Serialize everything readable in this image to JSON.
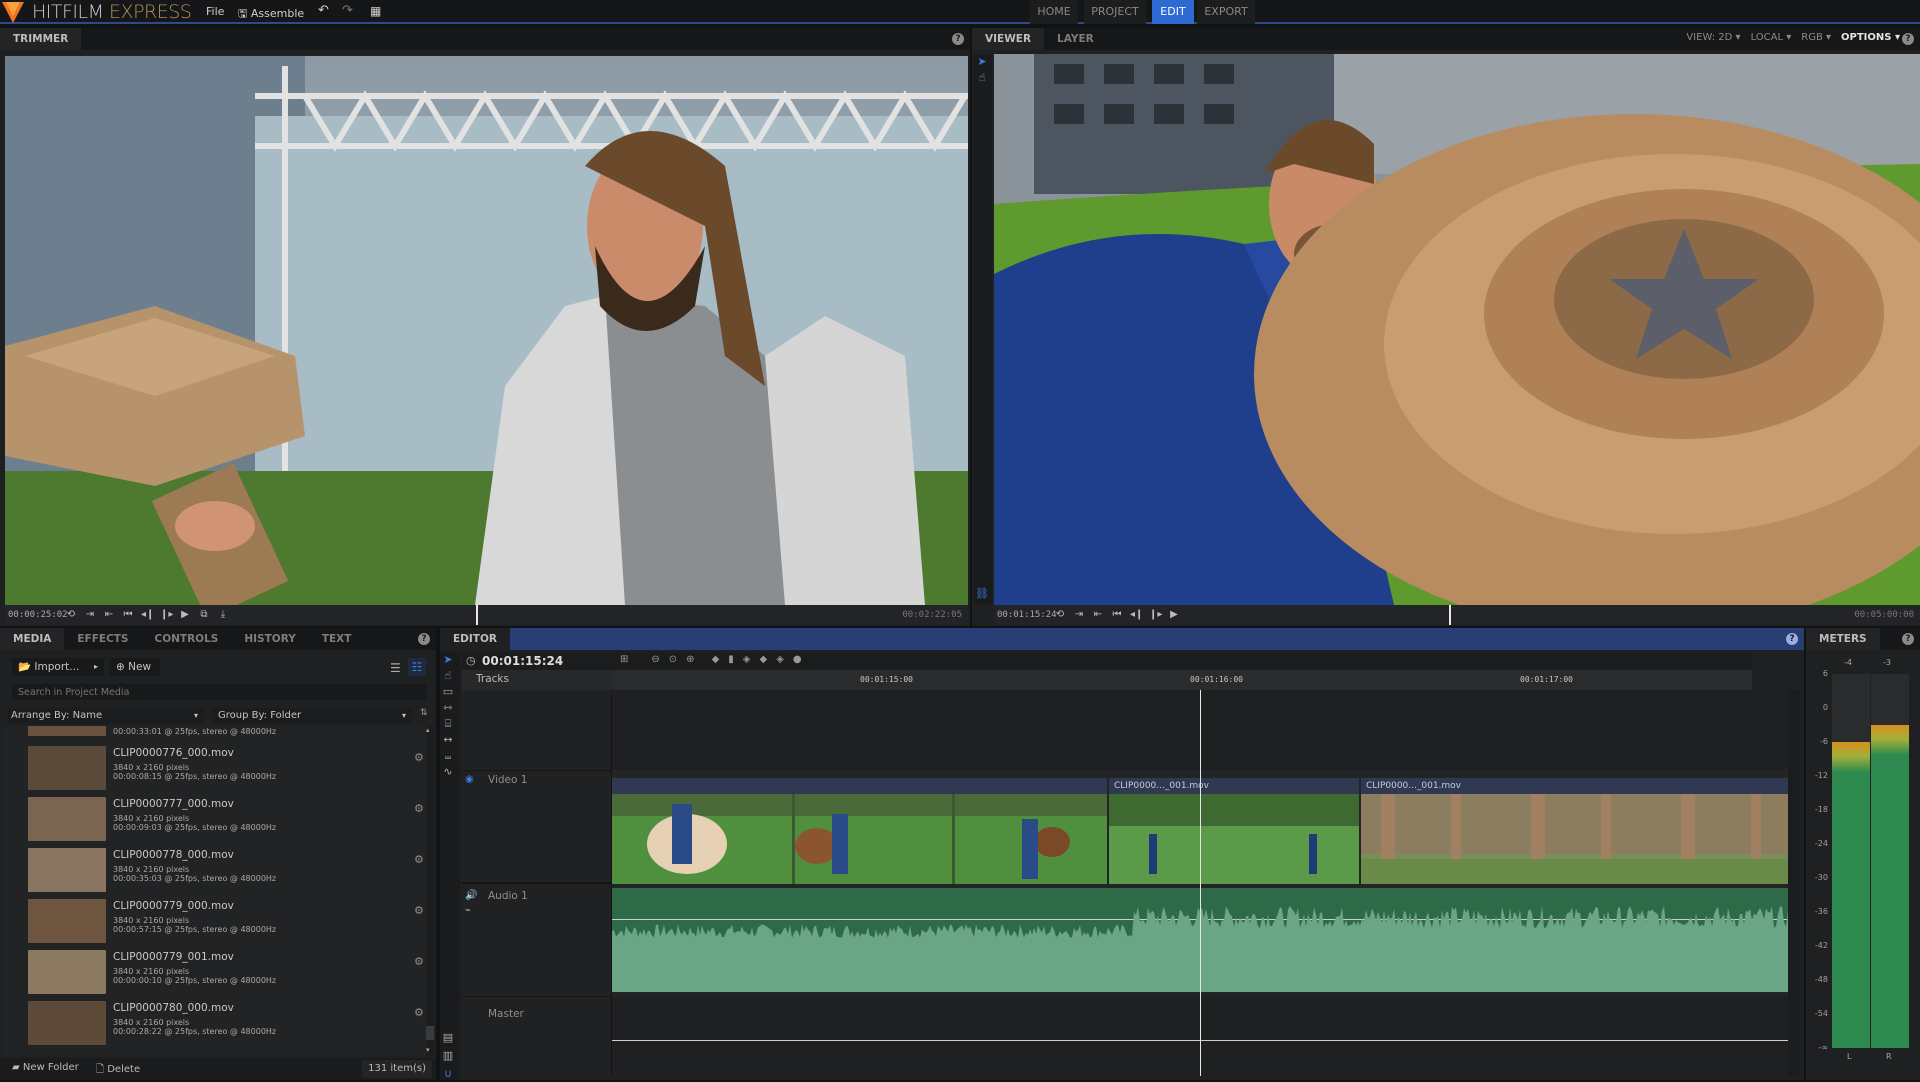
{
  "app": {
    "brand_main": "HITFILM",
    "brand_sub": " EXPRESS",
    "accent": "#2e6ad1"
  },
  "menu": {
    "file": "File",
    "assemble": "Assemble",
    "undo_icon": "undo-icon",
    "redo_icon": "redo-icon",
    "grid_icon": "grid-icon"
  },
  "nav_tabs": [
    {
      "label": "HOME",
      "active": false
    },
    {
      "label": "PROJECT",
      "active": false
    },
    {
      "label": "EDIT",
      "active": true
    },
    {
      "label": "EXPORT",
      "active": false
    }
  ],
  "trimmer": {
    "tab": "TRIMMER",
    "timecode": "00:00:25:02",
    "duration": "00:02:22:05",
    "playhead_fraction": 0.36
  },
  "viewer": {
    "tabs": [
      "VIEWER",
      "LAYER"
    ],
    "view_dropdown": "VIEW: 2D",
    "space_dropdown": "LOCAL",
    "channel_dropdown": "RGB",
    "options_dropdown": "OPTIONS",
    "timecode": "00:01:15:24",
    "duration": "00:05:00:00",
    "playhead_fraction": 0.41
  },
  "media_panel": {
    "tabs": [
      {
        "label": "MEDIA",
        "active": true
      },
      {
        "label": "EFFECTS",
        "active": false
      },
      {
        "label": "CONTROLS",
        "active": false
      },
      {
        "label": "HISTORY",
        "active": false
      },
      {
        "label": "TEXT",
        "active": false
      }
    ],
    "import_label": "Import...",
    "new_label": "New",
    "search_placeholder": "Search in Project Media",
    "arrange_by": "Arrange By: Name",
    "group_by": "Group By: Folder",
    "partial_top_info": "00:00:33:01 @ 25fps, stereo @ 48000Hz",
    "items": [
      {
        "name": "CLIP0000776_000.mov",
        "resolution": "3840 x 2160 pixels",
        "info": "00:00:08:15 @ 25fps, stereo @ 48000Hz",
        "color": "#5a4a3a"
      },
      {
        "name": "CLIP0000777_000.mov",
        "resolution": "3840 x 2160 pixels",
        "info": "00:00:09:03 @ 25fps, stereo @ 48000Hz",
        "color": "#7a6550"
      },
      {
        "name": "CLIP0000778_000.mov",
        "resolution": "3840 x 2160 pixels",
        "info": "00:00:35:03 @ 25fps, stereo @ 48000Hz",
        "color": "#8a7560"
      },
      {
        "name": "CLIP0000779_000.mov",
        "resolution": "3840 x 2160 pixels",
        "info": "00:00:57:15 @ 25fps, stereo @ 48000Hz",
        "color": "#6e5540"
      },
      {
        "name": "CLIP0000779_001.mov",
        "resolution": "3840 x 2160 pixels",
        "info": "00:00:00:10 @ 25fps, stereo @ 48000Hz",
        "color": "#8d7a62"
      },
      {
        "name": "CLIP0000780_000.mov",
        "resolution": "3840 x 2160 pixels",
        "info": "00:00:28:22 @ 25fps, stereo @ 48000Hz",
        "color": "#5d4a38"
      }
    ],
    "new_folder": "New Folder",
    "delete": "Delete",
    "item_count": "131 item(s)"
  },
  "editor": {
    "tab": "EDITOR",
    "timecode": "00:01:15:24",
    "tracks_label": "Tracks",
    "ruler": [
      "00:01:15:00",
      "00:01:16:00",
      "00:01:17:00"
    ],
    "tracks": {
      "video": "Video 1",
      "audio": "Audio 1",
      "master": "Master"
    },
    "clips": [
      {
        "label": "",
        "color": "#3e7a3a"
      },
      {
        "label": "CLIP0000..._001.mov",
        "color": "#4f8a44"
      },
      {
        "label": "CLIP0000..._001.mov",
        "color": "#6b7a4a"
      }
    ]
  },
  "meters": {
    "tab": "METERS",
    "peaks": [
      "-4",
      "-3"
    ],
    "scale": [
      "6",
      "0",
      "-6",
      "-12",
      "-18",
      "-24",
      "-30",
      "-36",
      "-42",
      "-48",
      "-54",
      "-∞"
    ],
    "channels": [
      "L",
      "R"
    ],
    "levels_db": [
      -6,
      -3
    ]
  }
}
